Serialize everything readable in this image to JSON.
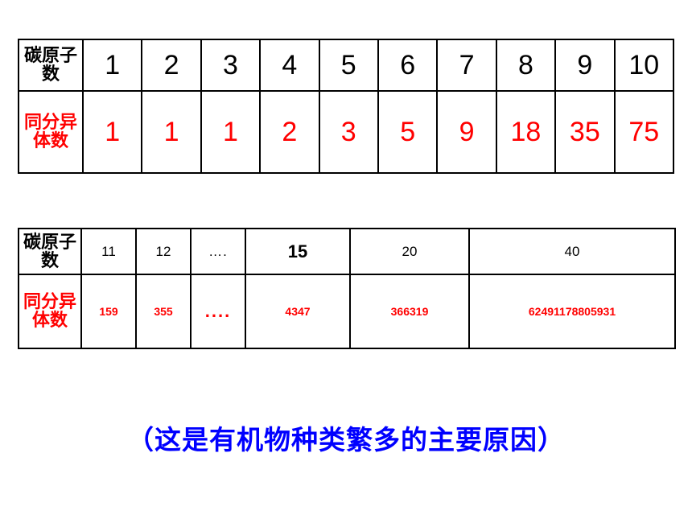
{
  "table_top": {
    "row1_label": "碳原子数",
    "row2_label": "同分异体数",
    "row1_values": [
      "1",
      "2",
      "3",
      "4",
      "5",
      "6",
      "7",
      "8",
      "9",
      "10"
    ],
    "row2_values": [
      "1",
      "1",
      "1",
      "2",
      "3",
      "5",
      "9",
      "18",
      "35",
      "75"
    ]
  },
  "table_bottom": {
    "row1_label": "碳原子数",
    "row2_label": "同分异体数",
    "row1_values": [
      "11",
      "12",
      "….",
      "15",
      "20",
      "40"
    ],
    "row2_values": [
      "159",
      "355",
      "....",
      "4347",
      "366319",
      "62491178805931"
    ]
  },
  "caption": "（这是有机物种类繁多的主要原因）",
  "colors": {
    "red": "#ff0000",
    "blue": "#0000ff",
    "black": "#000000"
  }
}
